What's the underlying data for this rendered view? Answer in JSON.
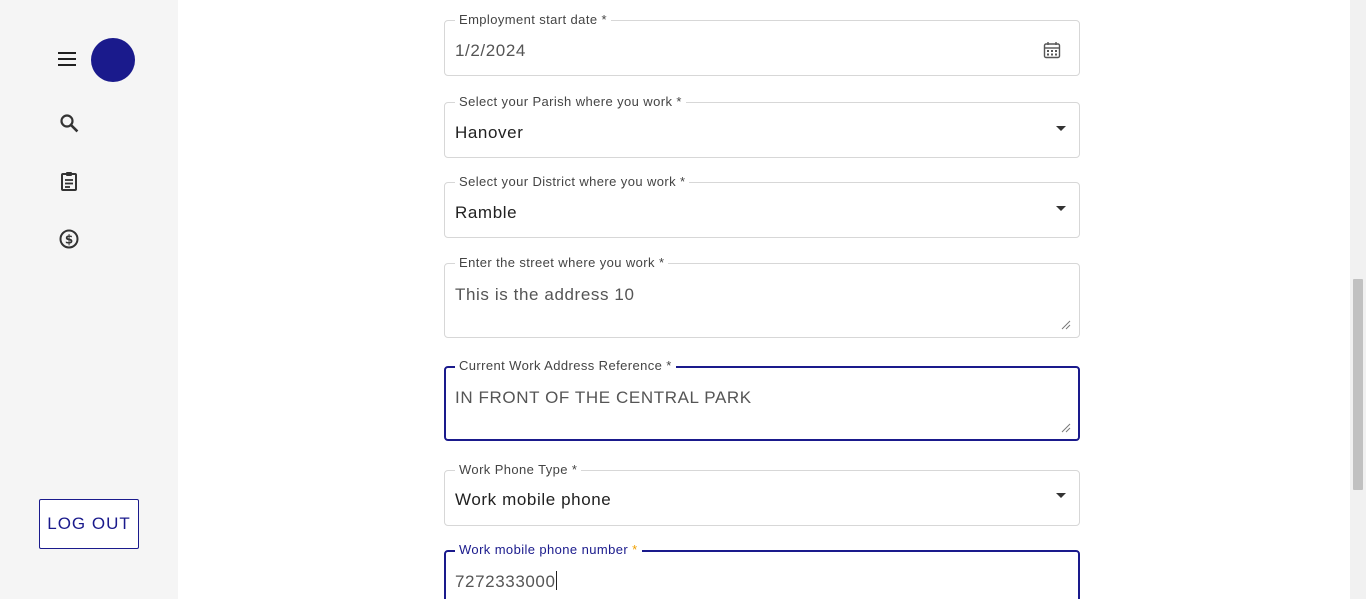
{
  "sidebar": {
    "menu_icon": "hamburger-menu-icon",
    "avatar_color": "#1a1a8c",
    "nav_icons": [
      "search-icon",
      "clipboard-icon",
      "dollar-icon"
    ],
    "logout_label": "LOG OUT"
  },
  "form": {
    "employment_start_date": {
      "label": "Employment start date *",
      "value": "1/2/2024"
    },
    "parish": {
      "label": "Select your Parish where you work *",
      "value": "Hanover"
    },
    "district": {
      "label": "Select your District where you work *",
      "value": "Ramble"
    },
    "street": {
      "label": "Enter the street where you work *",
      "value": "This is the address 10"
    },
    "reference": {
      "label": "Current Work Address Reference *",
      "value": "IN FRONT OF THE CENTRAL PARK"
    },
    "phone_type": {
      "label": "Work Phone Type *",
      "value": "Work mobile phone"
    },
    "mobile_number": {
      "label": "Work mobile phone number",
      "required_mark": "*",
      "value": "7272333000"
    }
  },
  "colors": {
    "accent": "#1a1a8c",
    "required": "#f0a000",
    "sidebar_bg": "#f5f5f5",
    "border": "#d7d7d7"
  }
}
